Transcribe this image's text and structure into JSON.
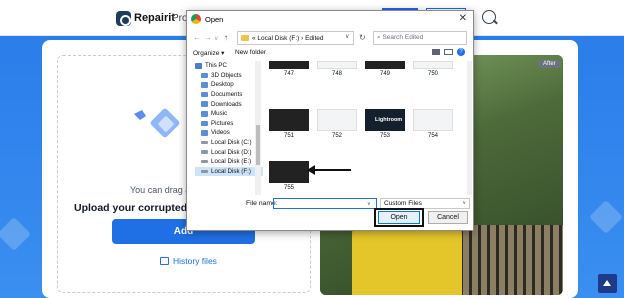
{
  "nav": {
    "brand": "Repairit",
    "link": "Prod"
  },
  "upload": {
    "drag_text": "You can drag and",
    "title": "Upload your corrupted ph",
    "add_label": "Add",
    "history_label": "History files"
  },
  "photo": {
    "badge": "After"
  },
  "dialog": {
    "title": "Open",
    "close": "✕",
    "address": "« Local Disk (F:) › Edited",
    "search_placeholder": "Search Edited",
    "organize": "Organize ▾",
    "new_folder": "New folder",
    "sidebar": [
      {
        "label": "This PC",
        "icon": "pc-icon",
        "indent": false,
        "selected": false
      },
      {
        "label": "3D Objects",
        "icon": "folder-3d-icon",
        "indent": true,
        "selected": false
      },
      {
        "label": "Desktop",
        "icon": "desktop-icon",
        "indent": true,
        "selected": false
      },
      {
        "label": "Documents",
        "icon": "documents-icon",
        "indent": true,
        "selected": false
      },
      {
        "label": "Downloads",
        "icon": "downloads-icon",
        "indent": true,
        "selected": false
      },
      {
        "label": "Music",
        "icon": "music-icon",
        "indent": true,
        "selected": false
      },
      {
        "label": "Pictures",
        "icon": "pictures-icon",
        "indent": true,
        "selected": false
      },
      {
        "label": "Videos",
        "icon": "videos-icon",
        "indent": true,
        "selected": false
      },
      {
        "label": "Local Disk (C:)",
        "icon": "drive-icon",
        "indent": true,
        "selected": false
      },
      {
        "label": "Local Disk (D:)",
        "icon": "drive-icon",
        "indent": true,
        "selected": false
      },
      {
        "label": "Local Disk (E:)",
        "icon": "drive-icon",
        "indent": true,
        "selected": false
      },
      {
        "label": "Local Disk (F:)",
        "icon": "drive-icon",
        "indent": true,
        "selected": true
      }
    ],
    "files": [
      {
        "name": "747",
        "style": "dark"
      },
      {
        "name": "748",
        "style": "light"
      },
      {
        "name": "749",
        "style": "dark"
      },
      {
        "name": "750",
        "style": "light"
      },
      {
        "name": "751",
        "style": "dark"
      },
      {
        "name": "752",
        "style": "light"
      },
      {
        "name": "753",
        "style": "lr"
      },
      {
        "name": "754",
        "style": "light"
      },
      {
        "name": "755",
        "style": "dark"
      }
    ],
    "lightroom_text": "Lightroom",
    "file_name_label": "File name:",
    "file_name_value": "",
    "file_type": "Custom Files",
    "open_label": "Open",
    "cancel_label": "Cancel"
  }
}
